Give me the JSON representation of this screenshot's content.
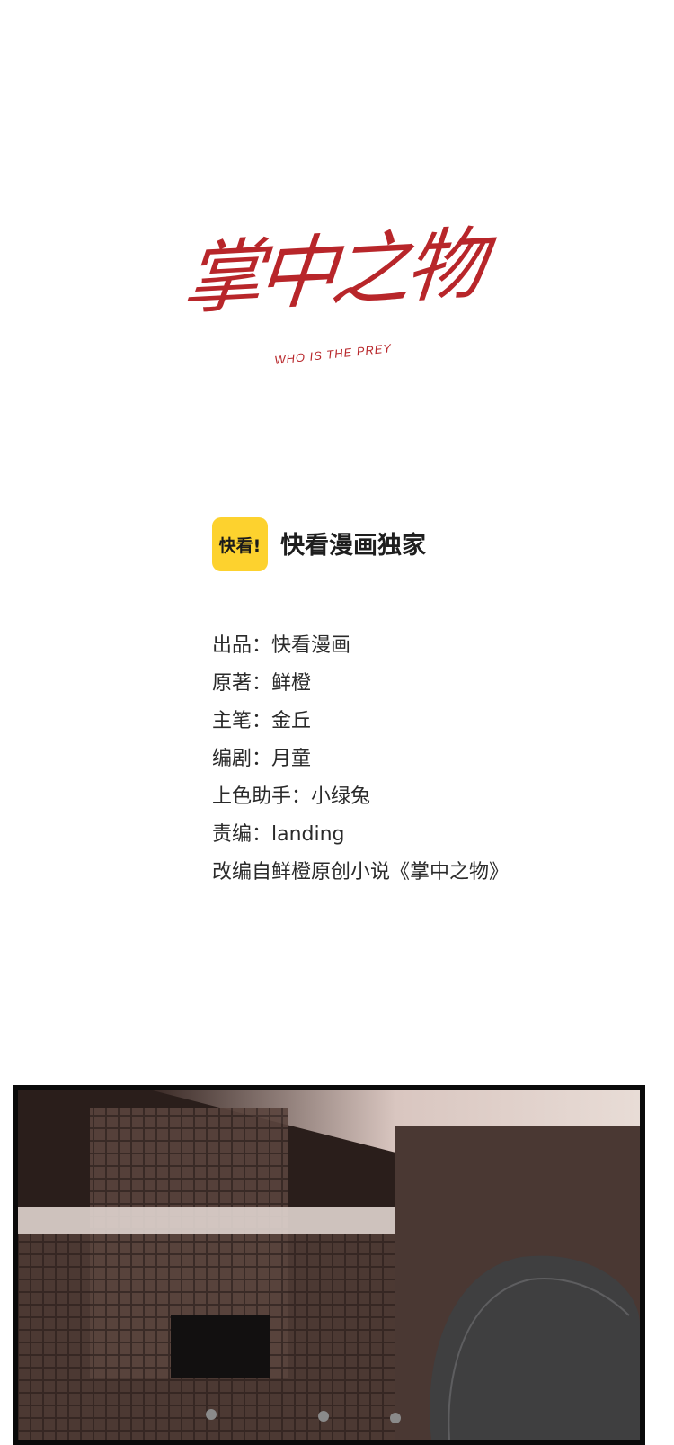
{
  "logo": {
    "title": "掌中之物",
    "subtitle": "WHO IS THE PREY",
    "color": "#b8262a"
  },
  "platform": {
    "badge_text": "快看!",
    "badge_color": "#fdd22e",
    "exclusive_text": "快看漫画独家"
  },
  "credits": [
    "出品：快看漫画",
    "原著：鲜橙",
    "主笔：金丘",
    "编剧：月童",
    "上色助手：小绿兔",
    "责编：landing",
    "改编自鲜橙原创小说《掌中之物》"
  ],
  "scene": {
    "description_icon": "comic-panel-interior"
  }
}
